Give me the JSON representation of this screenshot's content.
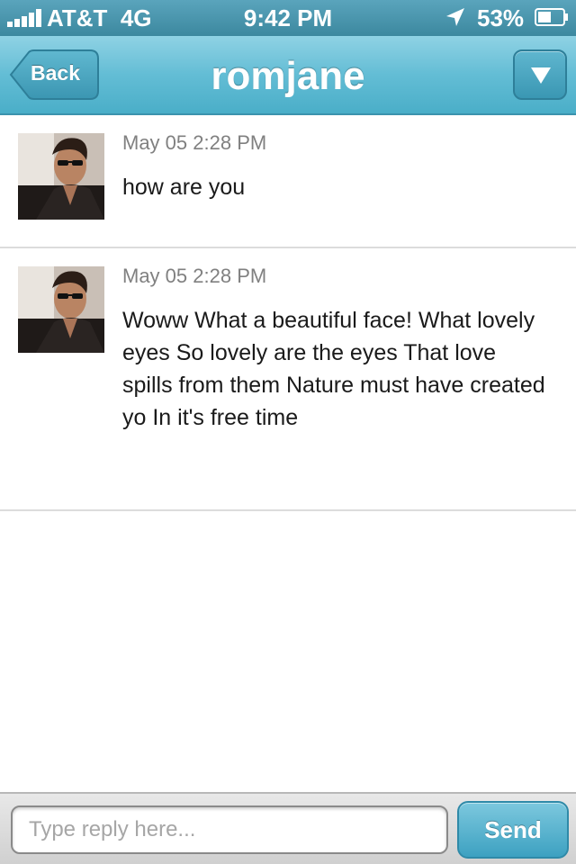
{
  "status_bar": {
    "carrier": "AT&T",
    "network": "4G",
    "time": "9:42 PM",
    "battery": "53%",
    "icons": [
      "signal-bars-icon",
      "location-arrow-icon",
      "battery-icon"
    ]
  },
  "nav": {
    "back_label": "Back",
    "title": "romjane",
    "menu_icon": "triangle-down-icon"
  },
  "messages": [
    {
      "timestamp": "May 05 2:28 PM",
      "text": "how are you"
    },
    {
      "timestamp": "May 05 2:28 PM",
      "text": "Woww What a beautiful face! What lovely eyes So lovely are the eyes That love spills from them Nature must have created yo In it's free time"
    }
  ],
  "reply": {
    "placeholder": "Type reply here...",
    "value": "",
    "send_label": "Send"
  },
  "colors": {
    "accent": "#4aaec8",
    "status_bar": "#3c889f",
    "timestamp": "#808080"
  }
}
